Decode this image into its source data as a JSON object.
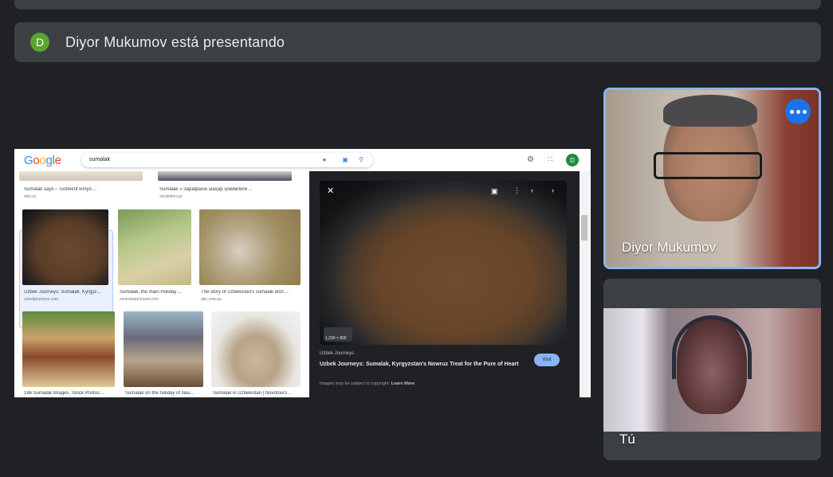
{
  "presenting": {
    "avatar_letter": "D",
    "text": "Diyor Mukumov está presentando",
    "avatar_color": "#5aa52f"
  },
  "browser": {
    "search_query": "sumalak",
    "avatar_letter": "D",
    "results": [
      {
        "caption": "Sumalak sayli – Toshkent kimyo ...",
        "source": "sticl.uz"
      },
      {
        "caption": "Sumalak » Зарафшон шаҳар ҳокимлиги ...",
        "source": "zarafshon.uz"
      },
      {
        "caption": "Uzbek Journeys: Sumalak, Kyrgyz...",
        "source": "uzbekjourneys.com"
      },
      {
        "caption": "Sumalak, the main Holiday ...",
        "source": "centralasia-travel.com"
      },
      {
        "caption": "The story of Uzbekistan's sumalak dish ...",
        "source": "abc.com.au"
      },
      {
        "caption": "186 Sumalak Images, Stock Photos ...",
        "source": ""
      },
      {
        "caption": "Sumalak on the holiday of Nau...",
        "source": ""
      },
      {
        "caption": "Sumalak in Uzbekistan | Novotours ...",
        "source": ""
      }
    ],
    "viewer": {
      "source": "Uzbek Journeys",
      "title": "Uzbek Journeys: Sumalak, Kyrgyzstan's Nowruz Treat for the Pure of Heart",
      "visit_label": "Visit",
      "copyright_text": "Images may be subject to copyright.",
      "learn_more": "Learn More",
      "size": "1,200 × 800"
    }
  },
  "participants": [
    {
      "name": "Diyor Mukumov",
      "active_speaker": true
    },
    {
      "name": "Tú",
      "active_speaker": false
    }
  ],
  "colors": {
    "accent": "#8ab4f8",
    "more_button": "#1a73e8",
    "background": "#202124",
    "panel": "#3c4043"
  }
}
